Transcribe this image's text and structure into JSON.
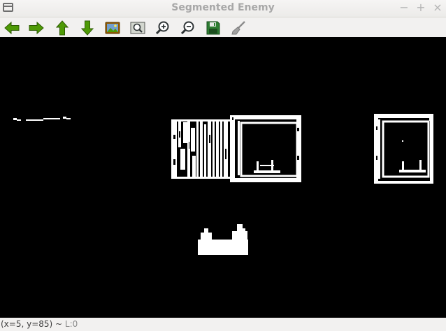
{
  "window": {
    "title": "Segmented Enemy"
  },
  "titlebar_buttons": {
    "minimize": "−",
    "maximize": "+",
    "close": "×"
  },
  "toolbar": {
    "items": [
      {
        "name": "pan-left",
        "icon": "arrow-left-icon"
      },
      {
        "name": "pan-right",
        "icon": "arrow-right-icon"
      },
      {
        "name": "pan-up",
        "icon": "arrow-up-icon"
      },
      {
        "name": "pan-down",
        "icon": "arrow-down-icon"
      },
      {
        "name": "load-image",
        "icon": "image-icon"
      },
      {
        "name": "zoom-to-fit",
        "icon": "zoom-fit-icon"
      },
      {
        "name": "zoom-in",
        "icon": "zoom-in-icon"
      },
      {
        "name": "zoom-out",
        "icon": "zoom-out-icon"
      },
      {
        "name": "save-image",
        "icon": "save-icon"
      },
      {
        "name": "properties",
        "icon": "brush-icon"
      }
    ],
    "colors": {
      "arrow_green": "#4e9a06",
      "save_green": "#2e7d32"
    }
  },
  "status": {
    "coords": "(x=5, y=85)",
    "separator": " ~ ",
    "level": "L:0"
  },
  "canvas": {
    "background": "#000000",
    "foreground": "#ffffff"
  }
}
